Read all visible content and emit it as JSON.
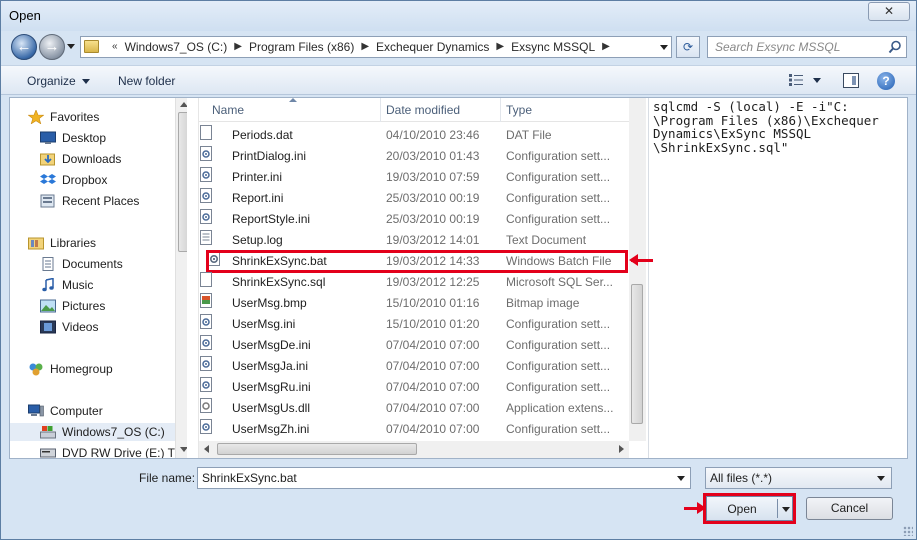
{
  "window": {
    "title": "Open",
    "close_label": "✕"
  },
  "nav": {
    "breadcrumbs": [
      "Windows7_OS (C:)",
      "Program Files (x86)",
      "Exchequer Dynamics",
      "Exsync MSSQL"
    ],
    "overflow_marker": "«",
    "search_placeholder": "Search Exsync MSSQL"
  },
  "toolbar": {
    "organize_label": "Organize",
    "new_folder_label": "New folder",
    "help_label": "?"
  },
  "sidebar": {
    "favorites": {
      "label": "Favorites",
      "items": [
        "Desktop",
        "Downloads",
        "Dropbox",
        "Recent Places"
      ]
    },
    "libraries": {
      "label": "Libraries",
      "items": [
        "Documents",
        "Music",
        "Pictures",
        "Videos"
      ]
    },
    "homegroup": {
      "label": "Homegroup"
    },
    "computer": {
      "label": "Computer",
      "items": [
        "Windows7_OS (C:)",
        "DVD RW Drive (E:) TSC"
      ]
    }
  },
  "filelist": {
    "columns": {
      "name": "Name",
      "date": "Date modified",
      "type": "Type"
    },
    "rows": [
      {
        "name": "Periods.dat",
        "date": "04/10/2010 23:46",
        "type": "DAT File",
        "icon": "blank-file-icon"
      },
      {
        "name": "PrintDialog.ini",
        "date": "20/03/2010 01:43",
        "type": "Configuration sett...",
        "icon": "config-file-icon"
      },
      {
        "name": "Printer.ini",
        "date": "19/03/2010 07:59",
        "type": "Configuration sett...",
        "icon": "config-file-icon"
      },
      {
        "name": "Report.ini",
        "date": "25/03/2010 00:19",
        "type": "Configuration sett...",
        "icon": "config-file-icon"
      },
      {
        "name": "ReportStyle.ini",
        "date": "25/03/2010 00:19",
        "type": "Configuration sett...",
        "icon": "config-file-icon"
      },
      {
        "name": "Setup.log",
        "date": "19/03/2012 14:01",
        "type": "Text Document",
        "icon": "text-file-icon"
      },
      {
        "name": "ShrinkExSync.bat",
        "date": "19/03/2012 14:33",
        "type": "Windows Batch File",
        "icon": "batch-file-icon"
      },
      {
        "name": "ShrinkExSync.sql",
        "date": "19/03/2012 12:25",
        "type": "Microsoft SQL Ser...",
        "icon": "sql-file-icon"
      },
      {
        "name": "UserMsg.bmp",
        "date": "15/10/2010 01:16",
        "type": "Bitmap image",
        "icon": "bitmap-file-icon"
      },
      {
        "name": "UserMsg.ini",
        "date": "15/10/2010 01:20",
        "type": "Configuration sett...",
        "icon": "config-file-icon"
      },
      {
        "name": "UserMsgDe.ini",
        "date": "07/04/2010 07:00",
        "type": "Configuration sett...",
        "icon": "config-file-icon"
      },
      {
        "name": "UserMsgJa.ini",
        "date": "07/04/2010 07:00",
        "type": "Configuration sett...",
        "icon": "config-file-icon"
      },
      {
        "name": "UserMsgRu.ini",
        "date": "07/04/2010 07:00",
        "type": "Configuration sett...",
        "icon": "config-file-icon"
      },
      {
        "name": "UserMsgUs.dll",
        "date": "07/04/2010 07:00",
        "type": "Application extens...",
        "icon": "dll-file-icon"
      },
      {
        "name": "UserMsgZh.ini",
        "date": "07/04/2010 07:00",
        "type": "Configuration sett...",
        "icon": "config-file-icon"
      }
    ]
  },
  "preview": {
    "text": "sqlcmd -S (local) -E -i\"C:\n\\Program Files (x86)\\Exchequer\nDynamics\\ExSync MSSQL\n\\ShrinkExSync.sql\""
  },
  "bottom": {
    "file_name_label": "File name:",
    "file_name_value": "ShrinkExSync.bat",
    "filter_value": "All files (*.*)",
    "open_label": "Open",
    "cancel_label": "Cancel"
  },
  "colors": {
    "highlight": "#e3001b",
    "chrome": "#d6e4f3"
  }
}
